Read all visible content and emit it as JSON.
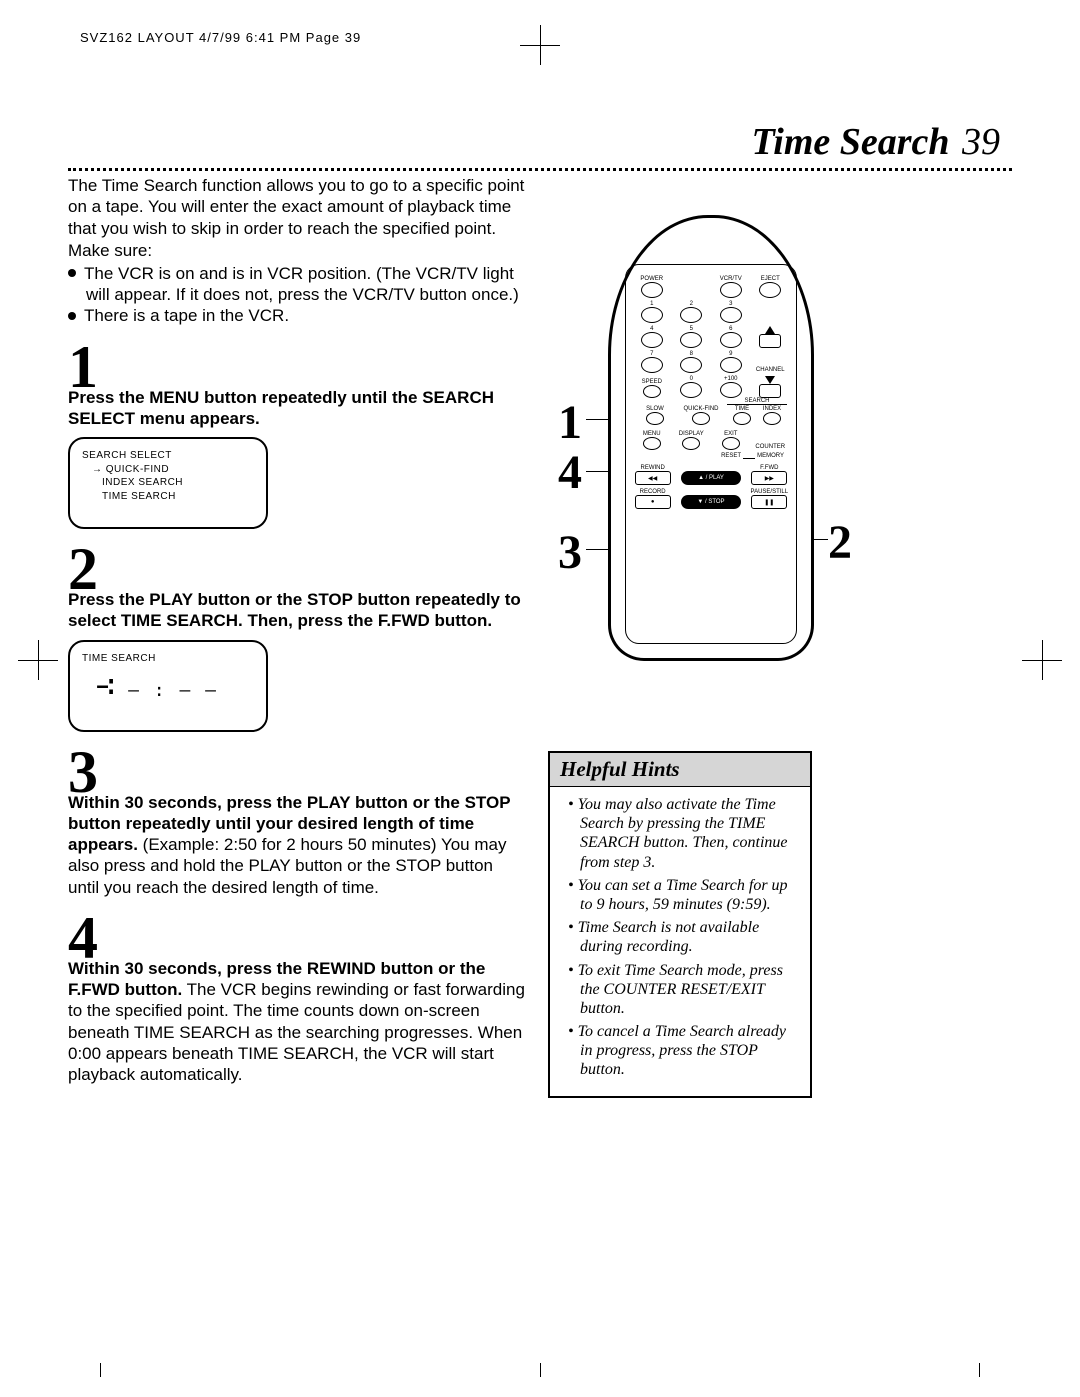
{
  "meta": {
    "header": "SVZ162 LAYOUT  4/7/99 6:41 PM  Page 39"
  },
  "title": {
    "text": "Time Search",
    "page": "39"
  },
  "intro": "The Time Search function allows you to go to a specific point on a tape. You will enter the exact amount of playback time that you wish to skip in order to reach the specified point.",
  "make_sure_label": "Make sure:",
  "bullets": [
    "The VCR is on and is in VCR position. (The VCR/TV light will appear. If it does not, press the VCR/TV button once.)",
    "There is a tape in the VCR."
  ],
  "steps": [
    {
      "num": "1",
      "bold": "Press the MENU button repeatedly until the SEARCH SELECT menu appears.",
      "rest": ""
    },
    {
      "num": "2",
      "bold": "Press the PLAY button or the STOP button repeatedly to select TIME SEARCH. Then, press the F.FWD button.",
      "rest": ""
    },
    {
      "num": "3",
      "bold": "Within 30 seconds, press the PLAY button or the STOP button repeatedly until your desired length of time appears.",
      "rest": "  (Example: 2:50 for 2 hours 50 minutes) You may also press and hold the PLAY button or the STOP button until you reach the desired length of time."
    },
    {
      "num": "4",
      "bold": "Within 30 seconds, press the REWIND button or the F.FWD button.",
      "rest": " The VCR begins rewinding or fast forwarding to the specified point. The time counts down on-screen beneath TIME SEARCH as the searching progresses. When 0:00 appears beneath TIME SEARCH, the VCR will start playback automatically."
    }
  ],
  "screen1": {
    "title": "SEARCH SELECT",
    "arrow": "→",
    "r1": "QUICK-FIND",
    "r2": "INDEX SEARCH",
    "r3": "TIME SEARCH"
  },
  "screen2": {
    "title": "TIME SEARCH",
    "blink": "- : - -"
  },
  "remote": {
    "row1": [
      "POWER",
      "VCR/TV",
      "EJECT"
    ],
    "nums": [
      "1",
      "2",
      "3",
      "4",
      "5",
      "6",
      "7",
      "8",
      "9"
    ],
    "channel": "CHANNEL",
    "row_speed": "SPEED",
    "zero": "0",
    "plus100": "+100",
    "row_slow": "SLOW",
    "quickfind": "QUICK-FIND",
    "search_label": "SEARCH",
    "time_label": "TIME",
    "index_label": "INDEX",
    "menu": "MENU",
    "display": "DISPLAY",
    "exit": "EXIT",
    "counter": "COUNTER",
    "reset": "RESET",
    "memory": "MEMORY",
    "rewind": "REWIND",
    "play": "▲ / PLAY",
    "ffwd": "F.FWD",
    "record": "RECORD",
    "stop": "▼ / STOP",
    "pause": "PAUSE/STILL"
  },
  "callouts": {
    "c1": "1",
    "c2": "2",
    "c3": "3",
    "c4": "4"
  },
  "hints": {
    "title": "Helpful Hints",
    "items": [
      "You may also activate the Time Search by pressing the TIME SEARCH button. Then, continue from step 3.",
      "You can set a Time Search for up to 9 hours, 59 minutes (9:59).",
      "Time Search is not available during recording.",
      "To exit Time Search mode, press the COUNTER RESET/EXIT button.",
      "To cancel a Time Search already in progress, press the STOP button."
    ]
  }
}
